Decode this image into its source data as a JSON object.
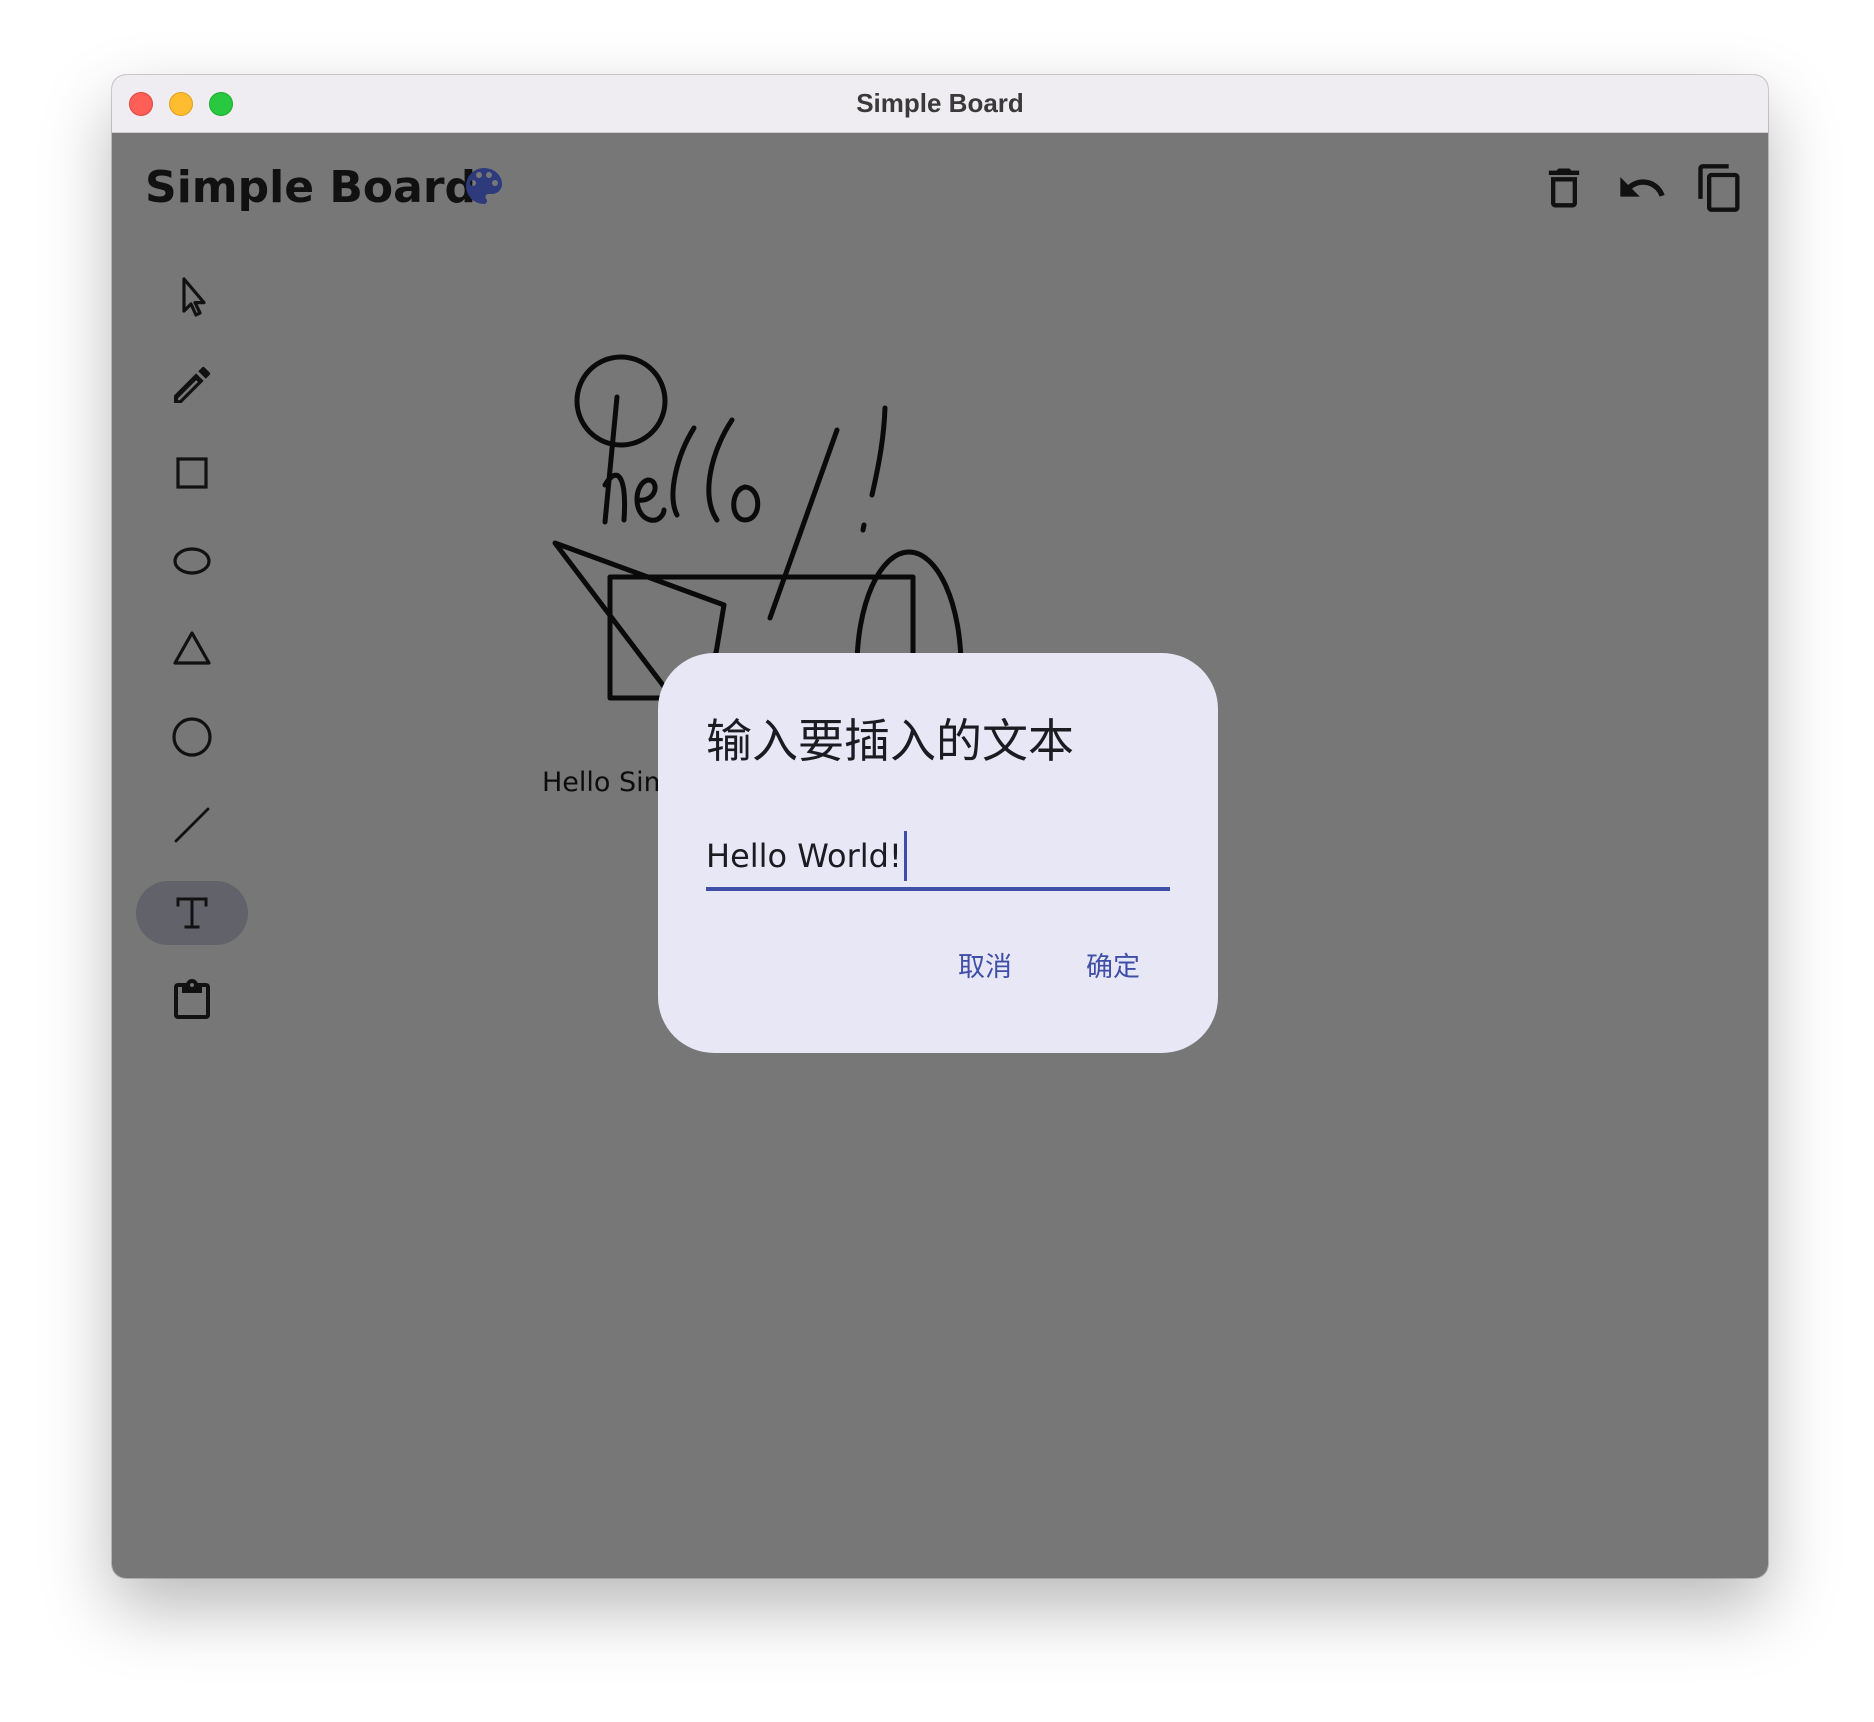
{
  "window": {
    "title": "Simple Board"
  },
  "header": {
    "title": "Simple Board",
    "palette_icon": "palette-icon",
    "actions": [
      {
        "name": "delete",
        "icon": "trash-icon"
      },
      {
        "name": "undo",
        "icon": "undo-icon"
      },
      {
        "name": "copy",
        "icon": "copy-icon"
      }
    ]
  },
  "tools": [
    {
      "name": "select",
      "icon": "cursor-arrow-icon",
      "active": false
    },
    {
      "name": "pen",
      "icon": "pencil-icon",
      "active": false
    },
    {
      "name": "rectangle",
      "icon": "rectangle-icon",
      "active": false
    },
    {
      "name": "ellipse",
      "icon": "ellipse-icon",
      "active": false
    },
    {
      "name": "triangle",
      "icon": "triangle-icon",
      "active": false
    },
    {
      "name": "circle",
      "icon": "circle-icon",
      "active": false
    },
    {
      "name": "line",
      "icon": "line-icon",
      "active": false
    },
    {
      "name": "text",
      "icon": "text-t-icon",
      "active": true
    },
    {
      "name": "clipboard",
      "icon": "clipboard-icon",
      "active": false
    }
  ],
  "canvas": {
    "text_item": "Hello Simple Board!"
  },
  "dialog": {
    "title": "输入要插入的文本",
    "input_value": "Hello World!",
    "cancel_label": "取消",
    "confirm_label": "确定"
  },
  "colors": {
    "scrim": "#777777",
    "dialog_bg": "#e8e7f5",
    "accent": "#3f4fa8",
    "palette_icon": "#2d3a7c",
    "active_tool_bg": "#62626a",
    "titlebar_bg": "#efedf2"
  }
}
